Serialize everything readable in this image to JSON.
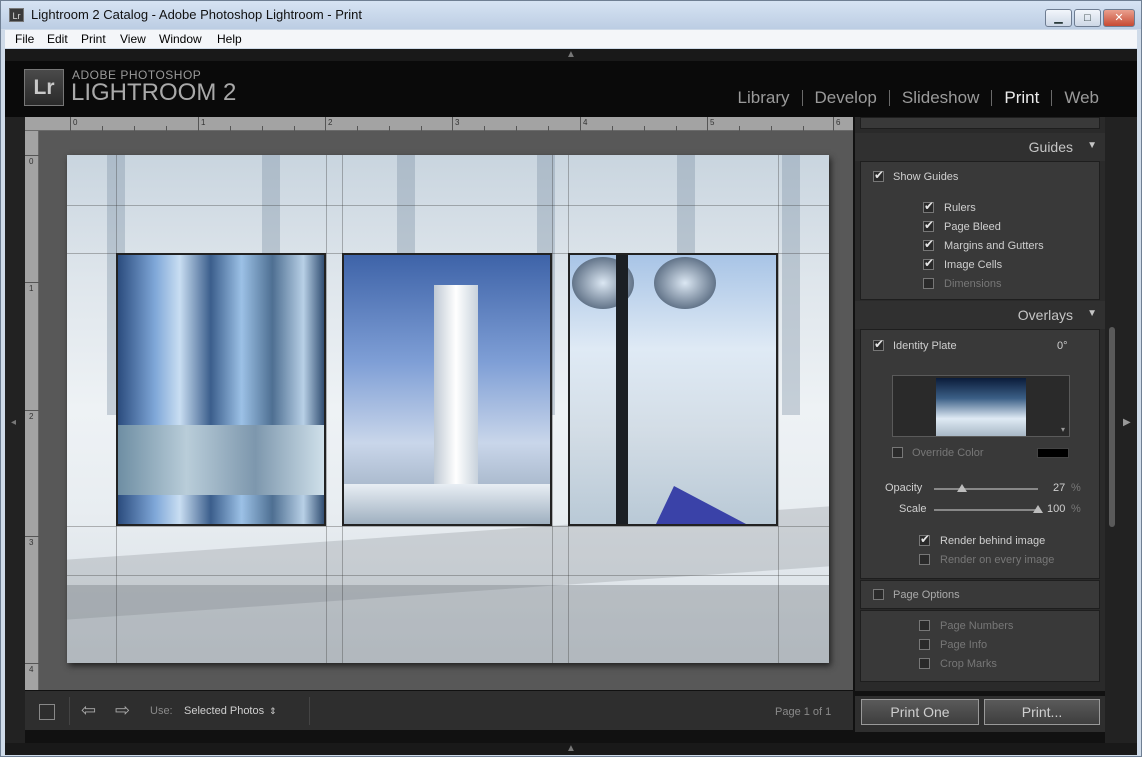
{
  "window": {
    "title": "Lightroom 2 Catalog - Adobe Photoshop Lightroom - Print",
    "controls": {
      "minimize": "▁",
      "maximize": "□",
      "close": "✕"
    }
  },
  "menu": [
    "File",
    "Edit",
    "Print",
    "View",
    "Window",
    "Help"
  ],
  "identity": {
    "logo": "Lr",
    "line1": "ADOBE PHOTOSHOP",
    "line2": "LIGHTROOM 2"
  },
  "modules": [
    {
      "label": "Library",
      "active": false
    },
    {
      "label": "Develop",
      "active": false
    },
    {
      "label": "Slideshow",
      "active": false
    },
    {
      "label": "Print",
      "active": true
    },
    {
      "label": "Web",
      "active": false
    }
  ],
  "rulers": {
    "h": [
      "0",
      "1",
      "2",
      "3",
      "4",
      "5",
      "6"
    ],
    "v": [
      "0",
      "1",
      "2",
      "3",
      "4"
    ]
  },
  "panel": {
    "guides": {
      "title": "Guides",
      "show_guides": {
        "label": "Show Guides",
        "checked": true
      },
      "items": [
        {
          "label": "Rulers",
          "checked": true
        },
        {
          "label": "Page Bleed",
          "checked": true
        },
        {
          "label": "Margins and Gutters",
          "checked": true
        },
        {
          "label": "Image Cells",
          "checked": true
        },
        {
          "label": "Dimensions",
          "checked": false
        }
      ]
    },
    "overlays": {
      "title": "Overlays",
      "identity_plate": {
        "label": "Identity Plate",
        "checked": true,
        "angle": "0°"
      },
      "override_color": {
        "label": "Override Color",
        "checked": false,
        "color": "#000000"
      },
      "opacity": {
        "label": "Opacity",
        "value": "27",
        "unit": "%",
        "fraction": 0.27
      },
      "scale": {
        "label": "Scale",
        "value": "100",
        "unit": "%",
        "fraction": 1.0
      },
      "render_behind": {
        "label": "Render behind image",
        "checked": true
      },
      "render_every": {
        "label": "Render on every image",
        "checked": false
      },
      "page_options": {
        "label": "Page Options",
        "checked": false
      },
      "page_items": [
        {
          "label": "Page Numbers",
          "checked": false
        },
        {
          "label": "Page Info",
          "checked": false
        },
        {
          "label": "Crop Marks",
          "checked": false
        }
      ]
    }
  },
  "toolbar": {
    "use_label": "Use:",
    "use_value": "Selected Photos",
    "page": "Page 1 of 1"
  },
  "buttons": {
    "print_one": "Print One",
    "print": "Print..."
  }
}
